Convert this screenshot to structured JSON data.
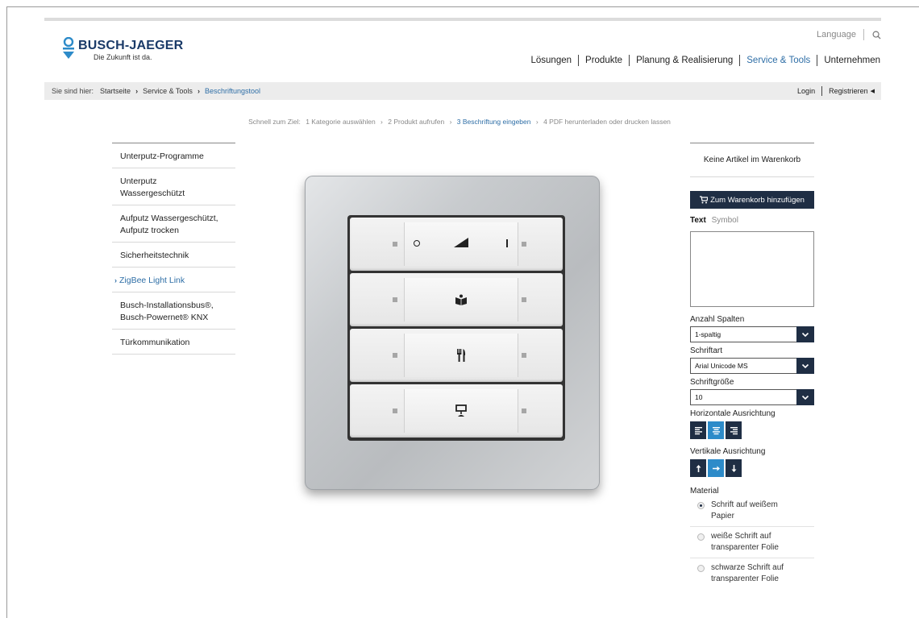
{
  "header": {
    "logo": {
      "name": "BUSCH-JAEGER",
      "claim": "Die Zukunft ist da.",
      "brand_color": "#1a3a68"
    },
    "language_label": "Language",
    "nav": [
      {
        "label": "Lösungen",
        "active": false
      },
      {
        "label": "Produkte",
        "active": false
      },
      {
        "label": "Planung & Realisierung",
        "active": false
      },
      {
        "label": "Service & Tools",
        "active": true
      },
      {
        "label": "Unternehmen",
        "active": false
      }
    ]
  },
  "breadcrumb": {
    "prefix": "Sie sind hier:",
    "items": [
      "Startseite",
      "Service & Tools",
      "Beschriftungstool"
    ],
    "login": "Login",
    "register": "Registrieren"
  },
  "steps": {
    "prefix": "Schnell zum Ziel:",
    "items": [
      {
        "label": "1 Kategorie auswählen",
        "active": false
      },
      {
        "label": "2 Produkt aufrufen",
        "active": false
      },
      {
        "label": "3 Beschriftung eingeben",
        "active": true
      },
      {
        "label": "4 PDF herunterladen oder drucken lassen",
        "active": false
      }
    ]
  },
  "categories": [
    {
      "label": "Unterputz-Programme",
      "active": false
    },
    {
      "label": "Unterputz\nWassergeschützt",
      "active": false
    },
    {
      "label": "Aufputz Wassergeschützt,\nAufputz trocken",
      "active": false
    },
    {
      "label": "Sicherheitstechnik",
      "active": false
    },
    {
      "label": "ZigBee Light Link",
      "active": true
    },
    {
      "label": "Busch-Installationsbus®,\nBusch-Powernet® KNX",
      "active": false
    },
    {
      "label": "Türkommunikation",
      "active": false
    }
  ],
  "switch": {
    "rockers": [
      {
        "symbol": "dimmer-symbols"
      },
      {
        "symbol": "book-icon"
      },
      {
        "symbol": "cutlery-icon"
      },
      {
        "symbol": "ceiling-lamp-icon"
      }
    ]
  },
  "panel": {
    "cart_status": "Keine Artikel im Warenkorb",
    "cart_button": "Zum Warenkorb hinzufügen",
    "tabs": [
      {
        "label": "Text",
        "active": true
      },
      {
        "label": "Symbol",
        "active": false
      }
    ],
    "textarea_value": "",
    "columns": {
      "label": "Anzahl Spalten",
      "value": "1-spaltig"
    },
    "font": {
      "label": "Schriftart",
      "value": "Arial Unicode MS"
    },
    "size": {
      "label": "Schriftgröße",
      "value": "10"
    },
    "halign": {
      "label": "Horizontale Ausrichtung",
      "options": [
        "align-left-icon",
        "align-center-icon",
        "align-right-icon"
      ],
      "selected": 1
    },
    "valign": {
      "label": "Vertikale Ausrichtung",
      "options": [
        "arrow-up-icon",
        "arrow-right-icon",
        "arrow-down-icon"
      ],
      "selected": 1
    },
    "material": {
      "label": "Material",
      "options": [
        {
          "label": "Schrift auf weißem\nPapier",
          "checked": true
        },
        {
          "label": "weiße Schrift auf\ntransparenter Folie",
          "checked": false
        },
        {
          "label": "schwarze Schrift auf\ntransparenter Folie",
          "checked": false
        }
      ]
    },
    "colors": {
      "dark": "#1f2e44",
      "active": "#2d8bc9",
      "link": "#2e6ea6"
    }
  }
}
